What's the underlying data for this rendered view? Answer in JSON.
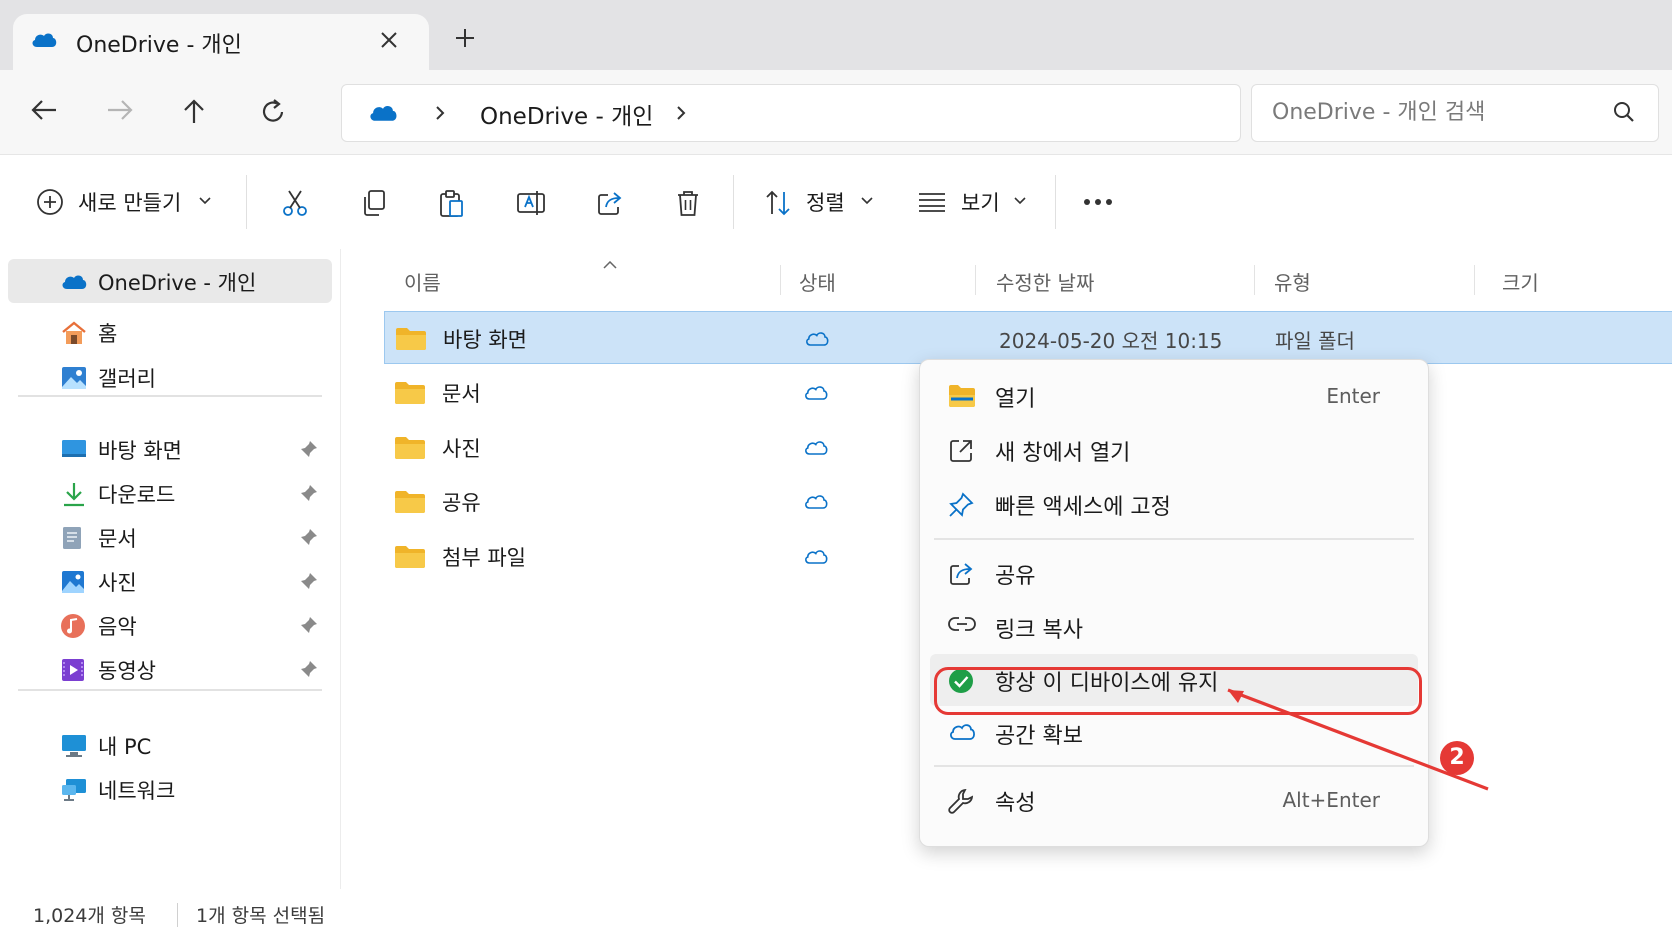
{
  "window": {
    "tab_title": "OneDrive - 개인"
  },
  "nav": {
    "breadcrumb": [
      "OneDrive - 개인"
    ],
    "search_placeholder": "OneDrive - 개인 검색"
  },
  "toolbar": {
    "new_label": "새로 만들기",
    "sort_label": "정렬",
    "view_label": "보기",
    "icons": [
      "cut-icon",
      "copy-icon",
      "paste-icon",
      "rename-icon",
      "share-icon",
      "delete-icon",
      "more-icon"
    ]
  },
  "sidebar": {
    "top": [
      {
        "label": "OneDrive - 개인",
        "icon": "onedrive-cloud-icon"
      },
      {
        "label": "홈",
        "icon": "home-icon"
      },
      {
        "label": "갤러리",
        "icon": "gallery-icon"
      }
    ],
    "pinned": [
      {
        "label": "바탕 화면",
        "icon": "desktop-icon"
      },
      {
        "label": "다운로드",
        "icon": "download-icon"
      },
      {
        "label": "문서",
        "icon": "documents-icon"
      },
      {
        "label": "사진",
        "icon": "pictures-icon"
      },
      {
        "label": "음악",
        "icon": "music-icon"
      },
      {
        "label": "동영상",
        "icon": "videos-icon"
      }
    ],
    "devices": [
      {
        "label": "내 PC",
        "icon": "pc-icon"
      },
      {
        "label": "네트워크",
        "icon": "network-icon"
      }
    ]
  },
  "file_list": {
    "columns": [
      "이름",
      "상태",
      "수정한 날짜",
      "유형",
      "크기"
    ],
    "rows": [
      {
        "name": "바탕 화면",
        "date": "2024-05-20 오전 10:15",
        "type": "파일 폴더",
        "selected": true
      },
      {
        "name": "문서",
        "date": "",
        "type": "",
        "selected": false
      },
      {
        "name": "사진",
        "date": "",
        "type": "",
        "selected": false
      },
      {
        "name": "공유",
        "date": "",
        "type": "",
        "selected": false
      },
      {
        "name": "첨부 파일",
        "date": "",
        "type": "",
        "selected": false
      }
    ]
  },
  "context_menu": {
    "items": [
      {
        "label": "열기",
        "shortcut": "Enter",
        "icon": "open-folder-icon"
      },
      {
        "label": "새 창에서 열기",
        "shortcut": "",
        "icon": "open-new-window-icon"
      },
      {
        "label": "빠른 액세스에 고정",
        "shortcut": "",
        "icon": "pin-icon"
      },
      {
        "label": "공유",
        "shortcut": "",
        "icon": "share-icon"
      },
      {
        "label": "링크 복사",
        "shortcut": "",
        "icon": "link-icon"
      },
      {
        "label": "항상 이 디바이스에 유지",
        "shortcut": "",
        "icon": "check-circle-icon",
        "highlighted": true
      },
      {
        "label": "공간 확보",
        "shortcut": "",
        "icon": "cloud-icon"
      },
      {
        "label": "속성",
        "shortcut": "Alt+Enter",
        "icon": "wrench-icon"
      }
    ]
  },
  "annotation": {
    "step_number": "2",
    "color": "#e53935"
  },
  "status": {
    "item_count": "1,024개 항목",
    "selected_count": "1개 항목 선택됨"
  },
  "colors": {
    "accent": "#0a72c8",
    "selection": "#cce3f8",
    "folder": "#f7c948"
  }
}
